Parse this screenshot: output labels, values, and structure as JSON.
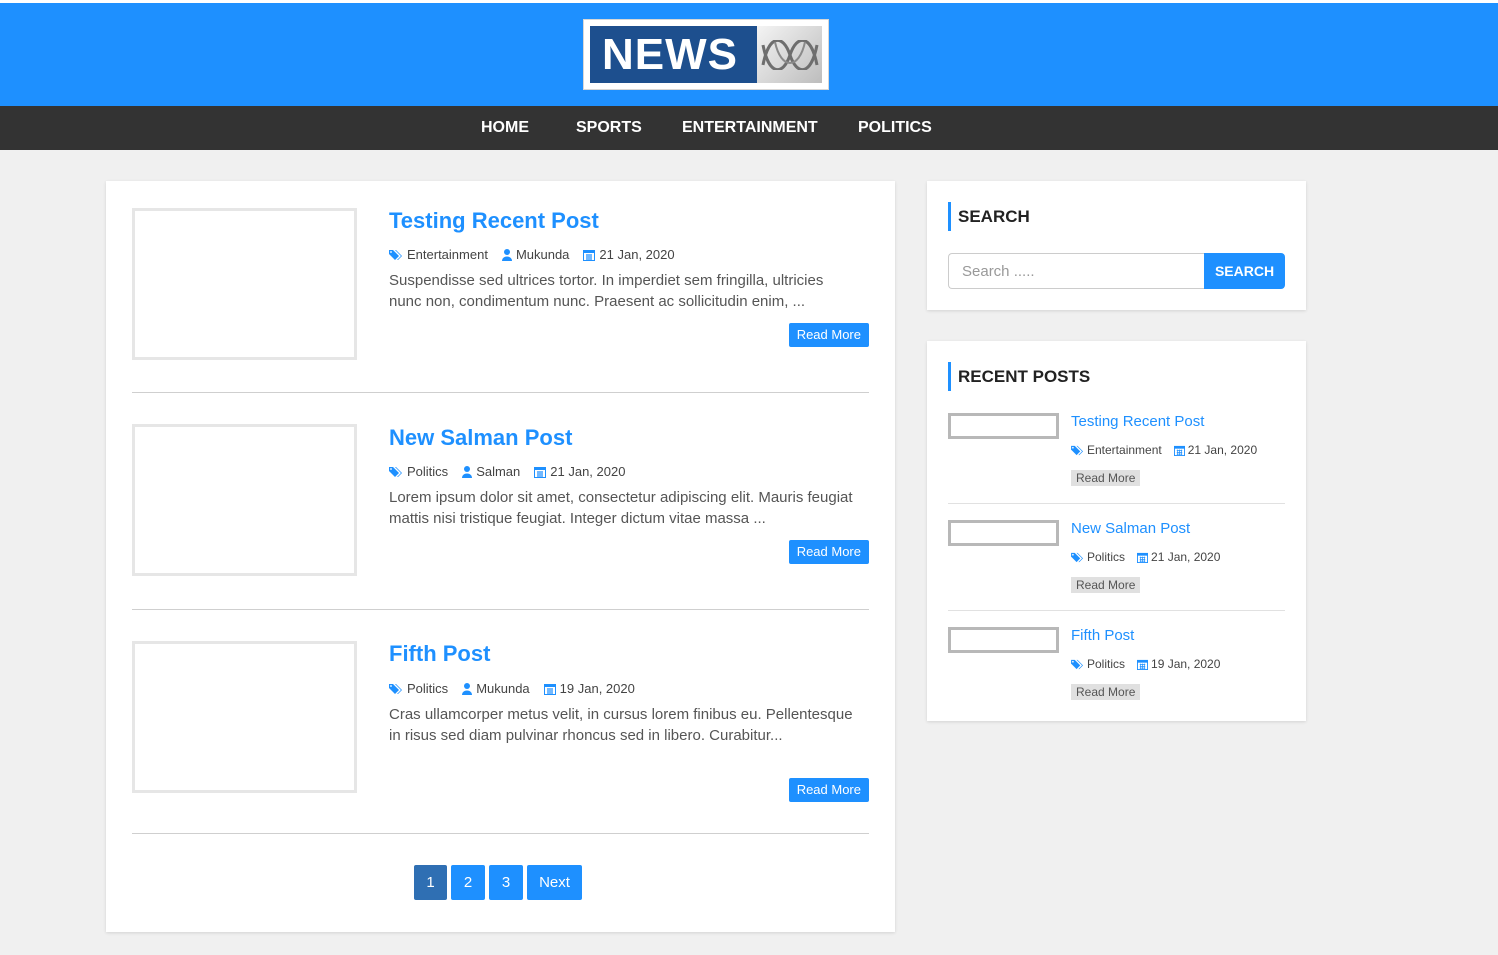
{
  "header": {
    "logo_text": "NEWS",
    "logo_mark": "abc-lissajous-logo",
    "bg_color": "#1e90ff"
  },
  "nav": {
    "items": [
      {
        "label": "HOME"
      },
      {
        "label": "SPORTS"
      },
      {
        "label": "ENTERTAINMENT"
      },
      {
        "label": "POLITICS"
      }
    ]
  },
  "posts": [
    {
      "title": "Testing Recent Post",
      "category": "Entertainment",
      "author": "Mukunda",
      "date": "21 Jan, 2020",
      "excerpt": "Suspendisse sed ultrices tortor. In imperdiet sem fringilla, ultricies nunc non, condimentum nunc. Praesent ac sollicitudin enim, ...",
      "read_more": "Read More"
    },
    {
      "title": "New Salman Post",
      "category": "Politics",
      "author": "Salman",
      "date": "21 Jan, 2020",
      "excerpt": "Lorem ipsum dolor sit amet, consectetur adipiscing elit. Mauris feugiat mattis nisi tristique feugiat. Integer dictum vitae massa ...",
      "read_more": "Read More"
    },
    {
      "title": "Fifth Post",
      "category": "Politics",
      "author": "Mukunda",
      "date": "19 Jan, 2020",
      "excerpt": "Cras ullamcorper metus velit, in cursus lorem finibus eu. Pellentesque in risus sed diam pulvinar rhoncus sed in libero. Curabitur...",
      "read_more": "Read More"
    }
  ],
  "pagination": {
    "pages": [
      "1",
      "2",
      "3"
    ],
    "current": "1",
    "next_label": "Next"
  },
  "sidebar": {
    "search": {
      "title": "SEARCH",
      "placeholder": "Search .....",
      "button_label": "SEARCH"
    },
    "recent": {
      "title": "RECENT POSTS",
      "items": [
        {
          "title": "Testing Recent Post",
          "category": "Entertainment",
          "date": "21 Jan, 2020",
          "read_more": "Read More"
        },
        {
          "title": "New Salman Post",
          "category": "Politics",
          "date": "21 Jan, 2020",
          "read_more": "Read More"
        },
        {
          "title": "Fifth Post",
          "category": "Politics",
          "date": "19 Jan, 2020",
          "read_more": "Read More"
        }
      ]
    }
  },
  "colors": {
    "accent": "#1e90ff",
    "nav_bg": "#333333",
    "page_bg": "#f0f0f0",
    "active_page": "#2f6fb3"
  },
  "icons": {
    "category": "tags-icon",
    "author": "user-icon",
    "date": "calendar-icon"
  }
}
